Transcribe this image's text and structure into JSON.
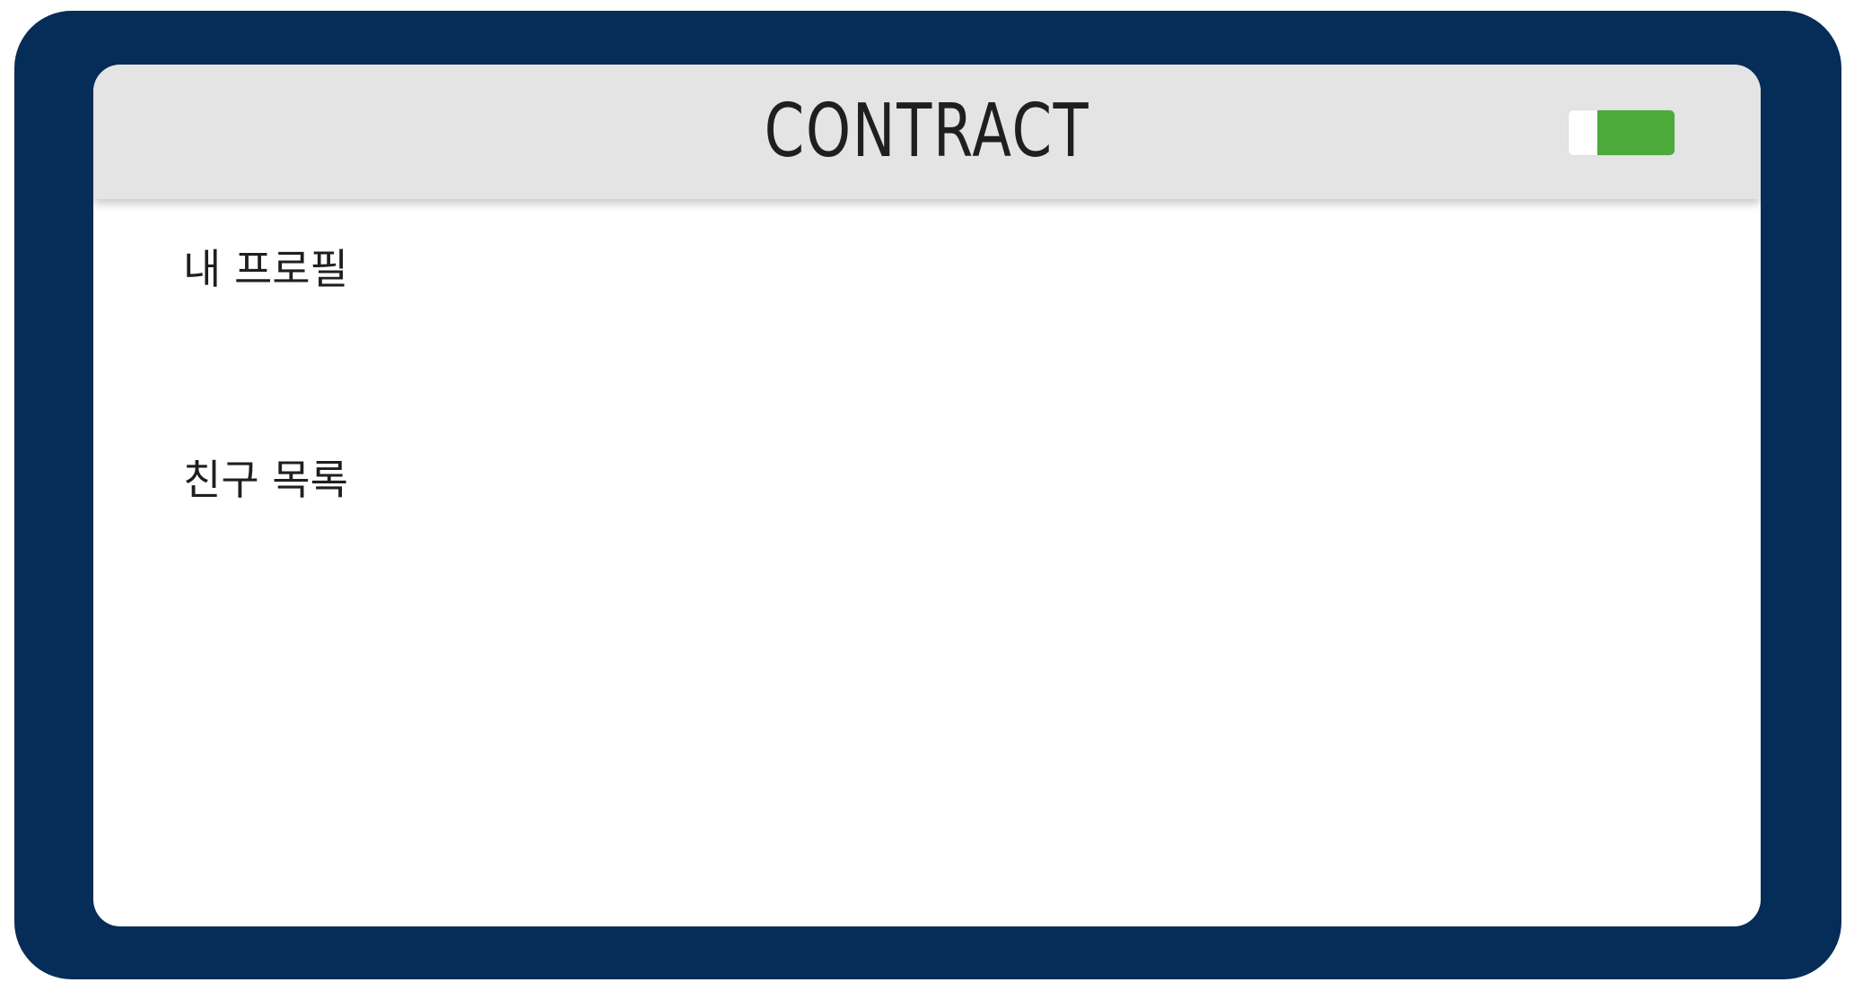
{
  "header": {
    "title": "CONTRACT"
  },
  "toggle": {
    "on": true,
    "level": 0.73,
    "colors": {
      "on": "#4caa3b",
      "track": "#ffffff"
    }
  },
  "sections": {
    "my_profile": "내 프로필",
    "friends_list": "친구 목록"
  },
  "colors": {
    "frame": "#062c58",
    "header_bg": "#e4e4e4",
    "screen_bg": "#ffffff",
    "text": "#1f1f1f"
  }
}
